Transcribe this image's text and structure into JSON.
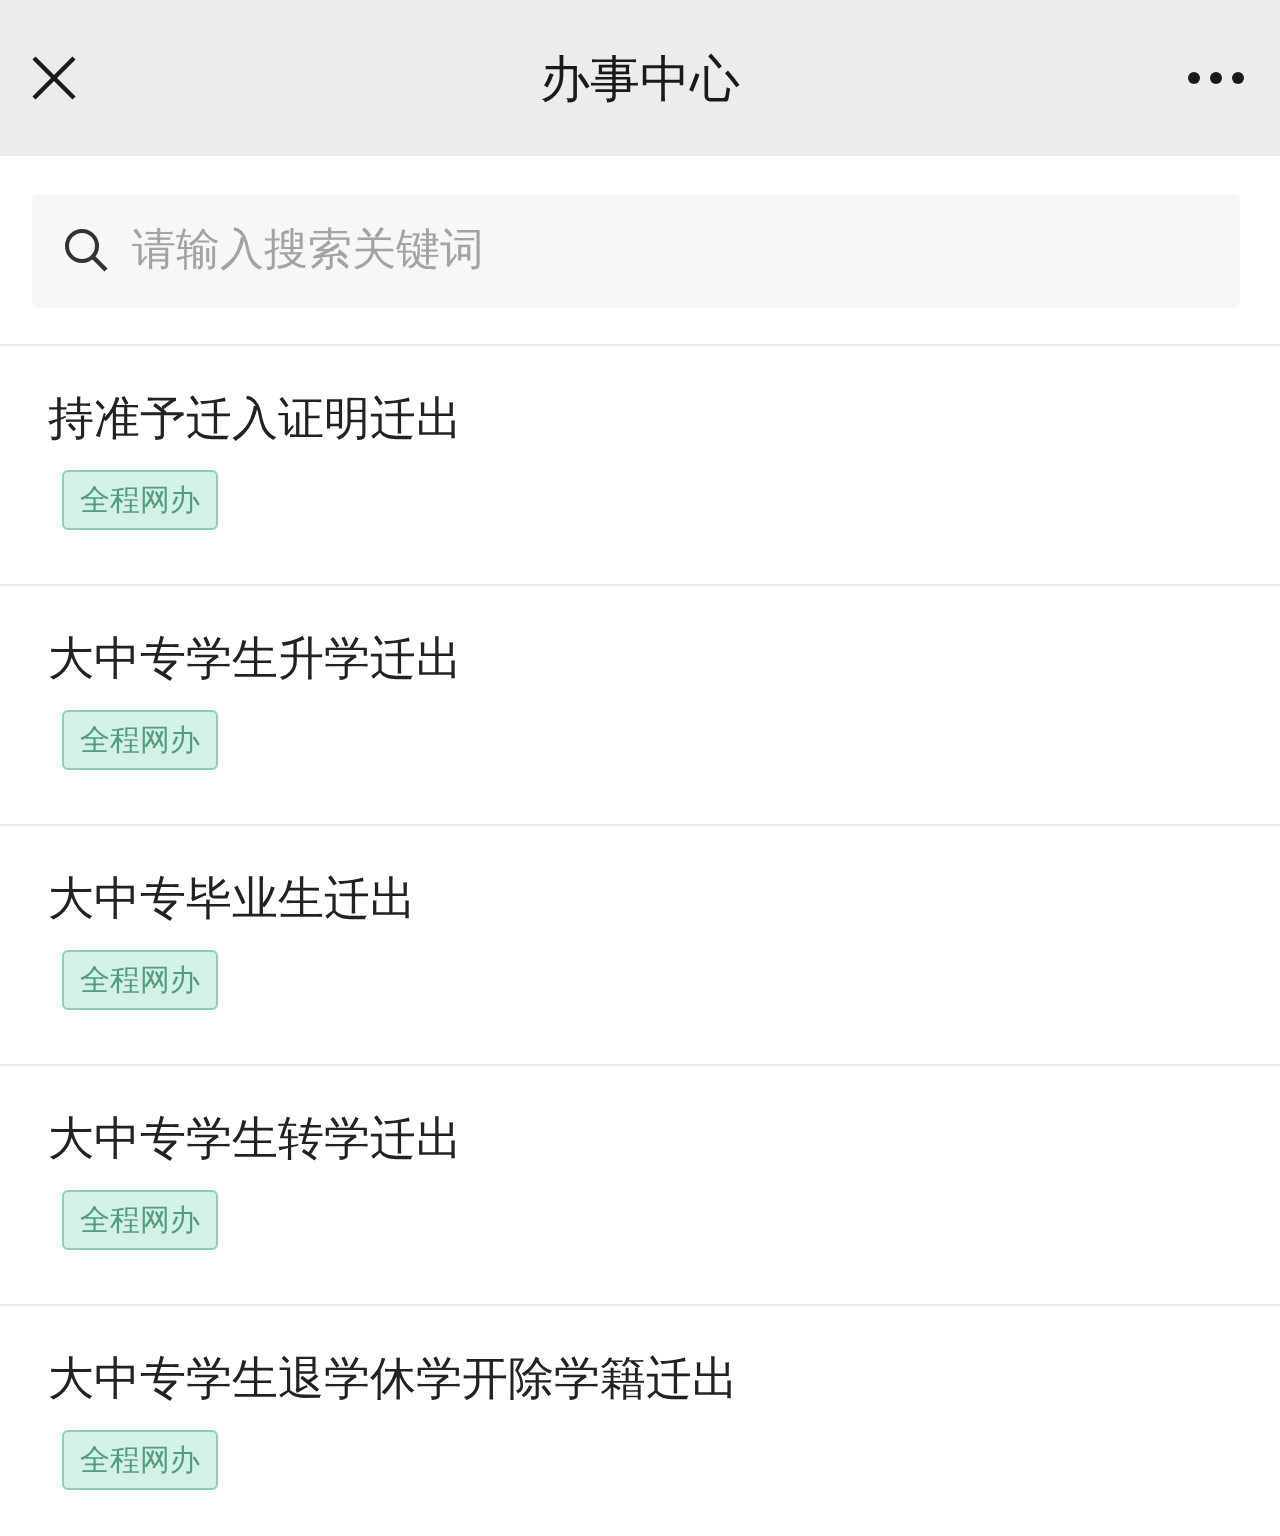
{
  "header": {
    "title": "办事中心"
  },
  "search": {
    "placeholder": "请输入搜索关键词"
  },
  "items": [
    {
      "title": "持准予迁入证明迁出",
      "tag": "全程网办"
    },
    {
      "title": "大中专学生升学迁出",
      "tag": "全程网办"
    },
    {
      "title": "大中专毕业生迁出",
      "tag": "全程网办"
    },
    {
      "title": "大中专学生转学迁出",
      "tag": "全程网办"
    },
    {
      "title": "大中专学生退学休学开除学籍迁出",
      "tag": "全程网办"
    }
  ]
}
